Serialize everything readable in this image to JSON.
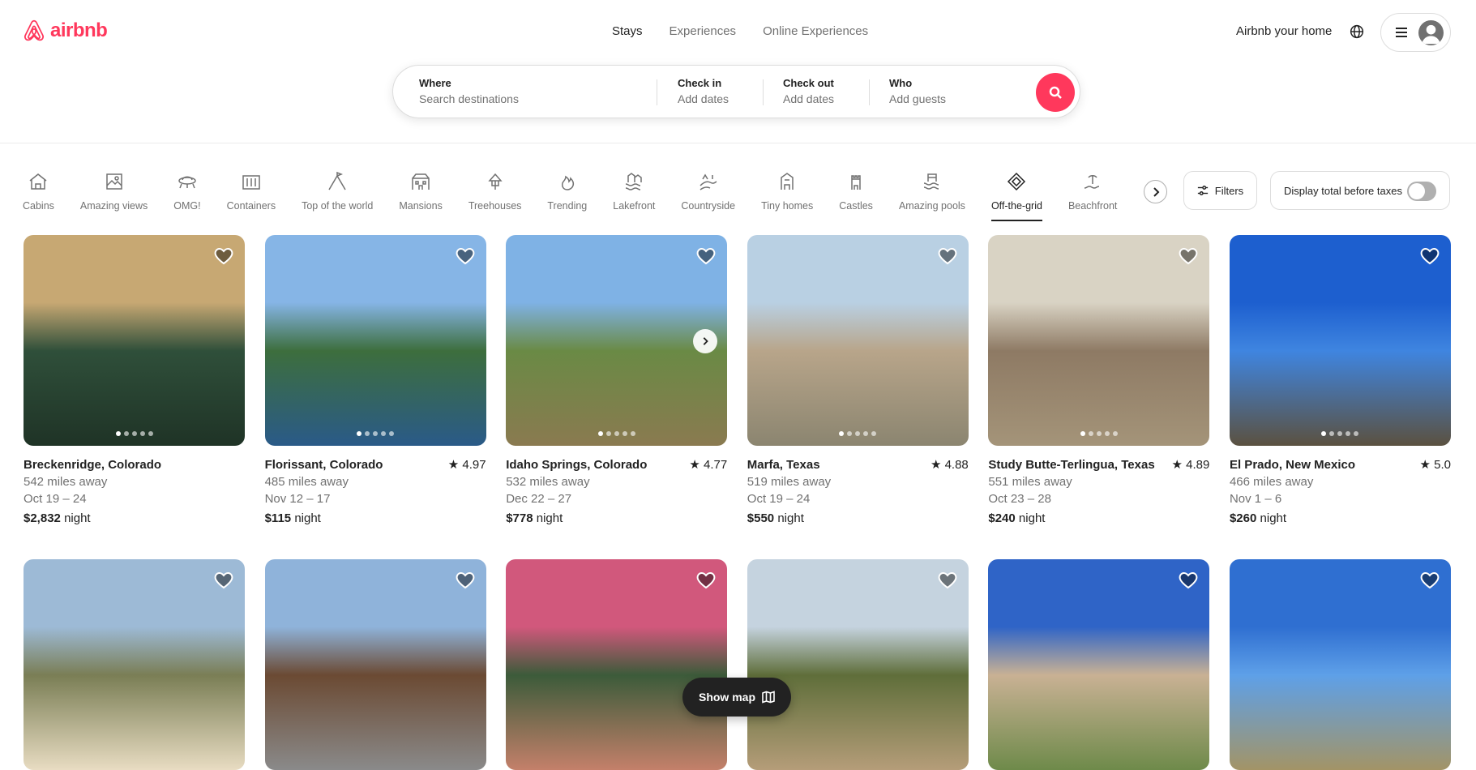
{
  "brand": {
    "name": "airbnb",
    "color": "#ff385c"
  },
  "nav": {
    "tabs": [
      "Stays",
      "Experiences",
      "Online Experiences"
    ],
    "active": "Stays"
  },
  "header": {
    "host_link": "Airbnb your home"
  },
  "search": {
    "where_label": "Where",
    "where_placeholder": "Search destinations",
    "checkin_label": "Check in",
    "checkin_placeholder": "Add dates",
    "checkout_label": "Check out",
    "checkout_placeholder": "Add dates",
    "who_label": "Who",
    "who_placeholder": "Add guests"
  },
  "categories": [
    {
      "label": "Cabins",
      "icon": "cabin-icon"
    },
    {
      "label": "Amazing views",
      "icon": "amazing-views-icon"
    },
    {
      "label": "OMG!",
      "icon": "omg-icon"
    },
    {
      "label": "Containers",
      "icon": "containers-icon"
    },
    {
      "label": "Top of the world",
      "icon": "top-of-the-world-icon"
    },
    {
      "label": "Mansions",
      "icon": "mansions-icon"
    },
    {
      "label": "Treehouses",
      "icon": "treehouses-icon"
    },
    {
      "label": "Trending",
      "icon": "trending-icon"
    },
    {
      "label": "Lakefront",
      "icon": "lakefront-icon"
    },
    {
      "label": "Countryside",
      "icon": "countryside-icon"
    },
    {
      "label": "Tiny homes",
      "icon": "tiny-homes-icon"
    },
    {
      "label": "Castles",
      "icon": "castles-icon"
    },
    {
      "label": "Amazing pools",
      "icon": "amazing-pools-icon"
    },
    {
      "label": "Off-the-grid",
      "icon": "off-the-grid-icon",
      "active": true
    },
    {
      "label": "Beachfront",
      "icon": "beachfront-icon"
    }
  ],
  "filters": {
    "label": "Filters"
  },
  "tax_toggle": {
    "label": "Display total before taxes",
    "on": false
  },
  "listings": [
    {
      "location": "Breckenridge, Colorado",
      "rating": "",
      "distance": "542 miles away",
      "dates": "Oct 19 – 24",
      "price": "$2,832",
      "unit": "night",
      "colors": [
        "#c7a873",
        "#2f4f3a",
        "#1f3326"
      ]
    },
    {
      "location": "Florissant, Colorado",
      "rating": "4.97",
      "distance": "485 miles away",
      "dates": "Nov 12 – 17",
      "price": "$115",
      "unit": "night",
      "colors": [
        "#86b5e6",
        "#3d6e3d",
        "#2a5a88"
      ]
    },
    {
      "location": "Idaho Springs, Colorado",
      "rating": "4.77",
      "distance": "532 miles away",
      "dates": "Dec 22 – 27",
      "price": "$778",
      "unit": "night",
      "colors": [
        "#7fb2e5",
        "#6a8a45",
        "#8a7a50"
      ]
    },
    {
      "location": "Marfa, Texas",
      "rating": "4.88",
      "distance": "519 miles away",
      "dates": "Oct 19 – 24",
      "price": "$550",
      "unit": "night",
      "colors": [
        "#b9d0e3",
        "#b8a58a",
        "#8b8570"
      ]
    },
    {
      "location": "Study Butte-Terlingua, Texas",
      "rating": "4.89",
      "distance": "551 miles away",
      "dates": "Oct 23 – 28",
      "price": "$240",
      "unit": "night",
      "colors": [
        "#d9d3c4",
        "#8e7a64",
        "#a49479"
      ]
    },
    {
      "location": "El Prado, New Mexico",
      "rating": "5.0",
      "distance": "466 miles away",
      "dates": "Nov 1 – 6",
      "price": "$260",
      "unit": "night",
      "colors": [
        "#1d5fcf",
        "#3f85e0",
        "#5b5140"
      ]
    },
    {
      "location": "",
      "rating": "",
      "distance": "",
      "dates": "",
      "price": "",
      "unit": "",
      "colors": [
        "#9dbad6",
        "#7a7e55",
        "#e8dcc2"
      ]
    },
    {
      "location": "",
      "rating": "",
      "distance": "",
      "dates": "",
      "price": "",
      "unit": "",
      "colors": [
        "#8fb3da",
        "#6b4a33",
        "#8a8a8a"
      ]
    },
    {
      "location": "",
      "rating": "",
      "distance": "",
      "dates": "",
      "price": "",
      "unit": "",
      "colors": [
        "#d1587c",
        "#3c5b3a",
        "#c4806a"
      ]
    },
    {
      "location": "",
      "rating": "",
      "distance": "",
      "dates": "",
      "price": "",
      "unit": "",
      "colors": [
        "#c5d3df",
        "#5f6e3a",
        "#b59d79"
      ]
    },
    {
      "location": "",
      "rating": "",
      "distance": "",
      "dates": "",
      "price": "",
      "unit": "",
      "colors": [
        "#2f64c7",
        "#c9b194",
        "#6e8a4a"
      ]
    },
    {
      "location": "",
      "rating": "",
      "distance": "",
      "dates": "",
      "price": "",
      "unit": "",
      "colors": [
        "#2f6fd1",
        "#5ea0e8",
        "#a39466"
      ]
    }
  ],
  "show_map": {
    "label": "Show map"
  }
}
